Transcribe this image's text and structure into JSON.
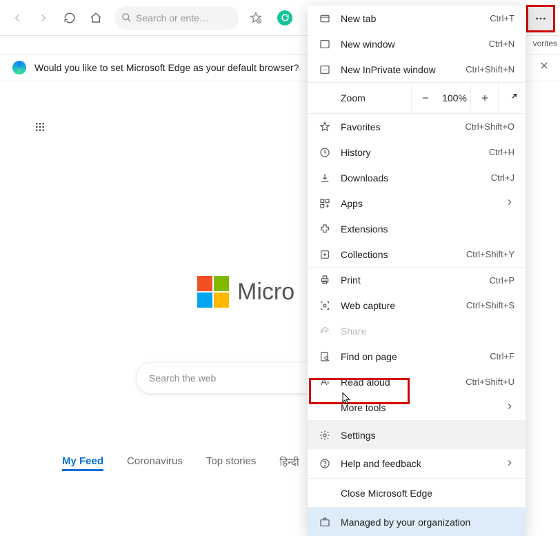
{
  "toolbar": {
    "address_placeholder": "Search or ente…",
    "vorites_fragment": "vorites"
  },
  "default_bar": {
    "message": "Would you like to set Microsoft Edge as your default browser?"
  },
  "content": {
    "logo_text": "Micro",
    "search_placeholder": "Search the web",
    "tabs": [
      "My Feed",
      "Coronavirus",
      "Top stories",
      "हिन्दी"
    ]
  },
  "zoom": {
    "label": "Zoom",
    "value": "100%"
  },
  "menu": [
    {
      "icon": "newtab",
      "label": "New tab",
      "hotkey": "Ctrl+T"
    },
    {
      "icon": "window",
      "label": "New window",
      "hotkey": "Ctrl+N"
    },
    {
      "icon": "inprivate",
      "label": "New InPrivate window",
      "hotkey": "Ctrl+Shift+N"
    },
    {
      "zoom": true
    },
    {
      "icon": "star",
      "label": "Favorites",
      "hotkey": "Ctrl+Shift+O"
    },
    {
      "icon": "history",
      "label": "History",
      "hotkey": "Ctrl+H"
    },
    {
      "icon": "download",
      "label": "Downloads",
      "hotkey": "Ctrl+J"
    },
    {
      "icon": "apps",
      "label": "Apps",
      "submenu": true
    },
    {
      "icon": "ext",
      "label": "Extensions"
    },
    {
      "icon": "collections",
      "label": "Collections",
      "hotkey": "Ctrl+Shift+Y"
    },
    {
      "sep": true,
      "icon": "print",
      "label": "Print",
      "hotkey": "Ctrl+P"
    },
    {
      "icon": "capture",
      "label": "Web capture",
      "hotkey": "Ctrl+Shift+S"
    },
    {
      "icon": "share",
      "label": "Share",
      "disabled": true
    },
    {
      "icon": "find",
      "label": "Find on page",
      "hotkey": "Ctrl+F"
    },
    {
      "icon": "read",
      "label": "Read aloud",
      "hotkey": "Ctrl+Shift+U"
    },
    {
      "label": "More tools",
      "submenu": true,
      "noicon": true
    },
    {
      "sep": true,
      "icon": "gear",
      "label": "Settings",
      "hover": true
    },
    {
      "icon": "help",
      "label": "Help and feedback",
      "submenu": true
    },
    {
      "sep": true,
      "label": "Close Microsoft Edge",
      "noicon": true
    },
    {
      "sep": true,
      "icon": "briefcase",
      "label": "Managed by your organization",
      "highlight": true
    }
  ]
}
